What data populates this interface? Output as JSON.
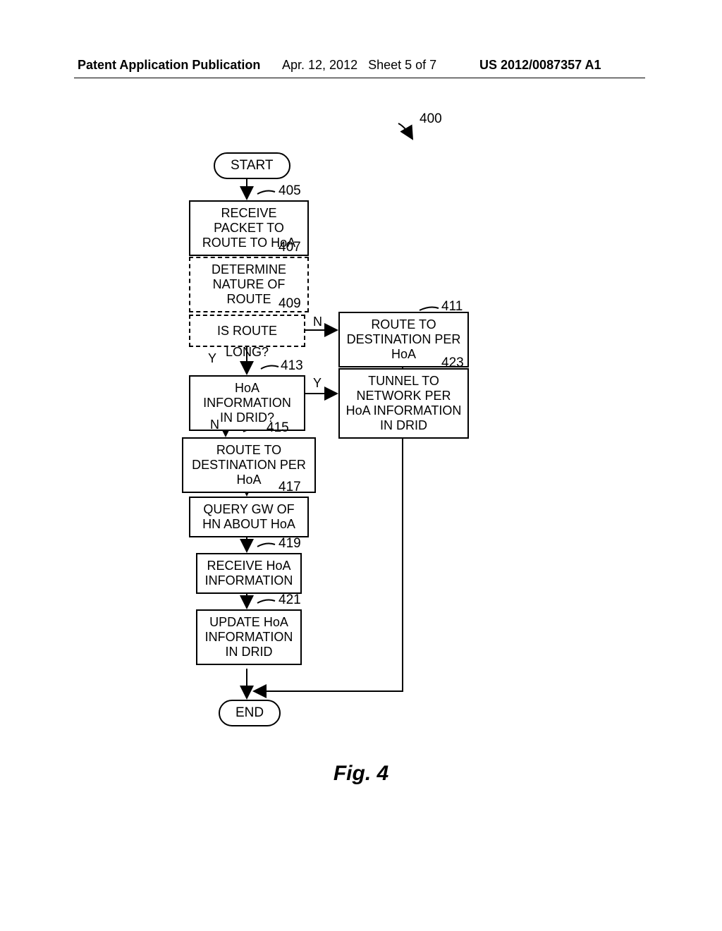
{
  "header": {
    "left": "Patent Application Publication",
    "date": "Apr. 12, 2012",
    "sheet": "Sheet 5 of 7",
    "docnum": "US 2012/0087357 A1"
  },
  "chart_data": {
    "type": "flowchart",
    "ref_number": "400",
    "nodes": [
      {
        "id": "start",
        "kind": "terminator",
        "text": "START"
      },
      {
        "id": "405",
        "kind": "process",
        "text": "RECEIVE PACKET TO ROUTE TO HoA",
        "ref": "405"
      },
      {
        "id": "407",
        "kind": "process-dashed",
        "text": "DETERMINE NATURE OF ROUTE",
        "ref": "407"
      },
      {
        "id": "409",
        "kind": "decision-dashed",
        "text": "IS ROUTE LONG?",
        "ref": "409"
      },
      {
        "id": "411",
        "kind": "process",
        "text": "ROUTE TO DESTINATION PER HoA",
        "ref": "411",
        "input_from": "409:N"
      },
      {
        "id": "413",
        "kind": "decision",
        "text": "HoA INFORMATION IN DRID?",
        "ref": "413",
        "input_from": "409:Y"
      },
      {
        "id": "423",
        "kind": "process",
        "text": "TUNNEL TO NETWORK PER HoA INFORMATION IN DRID",
        "ref": "423",
        "input_from": "413:Y"
      },
      {
        "id": "415",
        "kind": "process",
        "text": "ROUTE TO DESTINATION PER HoA",
        "ref": "415",
        "input_from": "413:N"
      },
      {
        "id": "417",
        "kind": "process",
        "text": "QUERY GW OF HN ABOUT HoA",
        "ref": "417"
      },
      {
        "id": "419",
        "kind": "process",
        "text": "RECEIVE HoA INFORMATION",
        "ref": "419"
      },
      {
        "id": "421",
        "kind": "process",
        "text": "UPDATE HoA INFORMATION IN DRID",
        "ref": "421"
      },
      {
        "id": "end",
        "kind": "terminator",
        "text": "END"
      }
    ],
    "edges": [
      {
        "from": "start",
        "to": "405"
      },
      {
        "from": "405",
        "to": "407"
      },
      {
        "from": "407",
        "to": "409"
      },
      {
        "from": "409",
        "to": "411",
        "label": "N"
      },
      {
        "from": "409",
        "to": "413",
        "label": "Y"
      },
      {
        "from": "413",
        "to": "423",
        "label": "Y"
      },
      {
        "from": "413",
        "to": "415",
        "label": "N"
      },
      {
        "from": "415",
        "to": "417"
      },
      {
        "from": "417",
        "to": "419"
      },
      {
        "from": "419",
        "to": "421"
      },
      {
        "from": "421",
        "to": "end"
      },
      {
        "from": "411",
        "to": "end"
      },
      {
        "from": "423",
        "to": "end"
      }
    ],
    "caption": "Fig. 4"
  }
}
